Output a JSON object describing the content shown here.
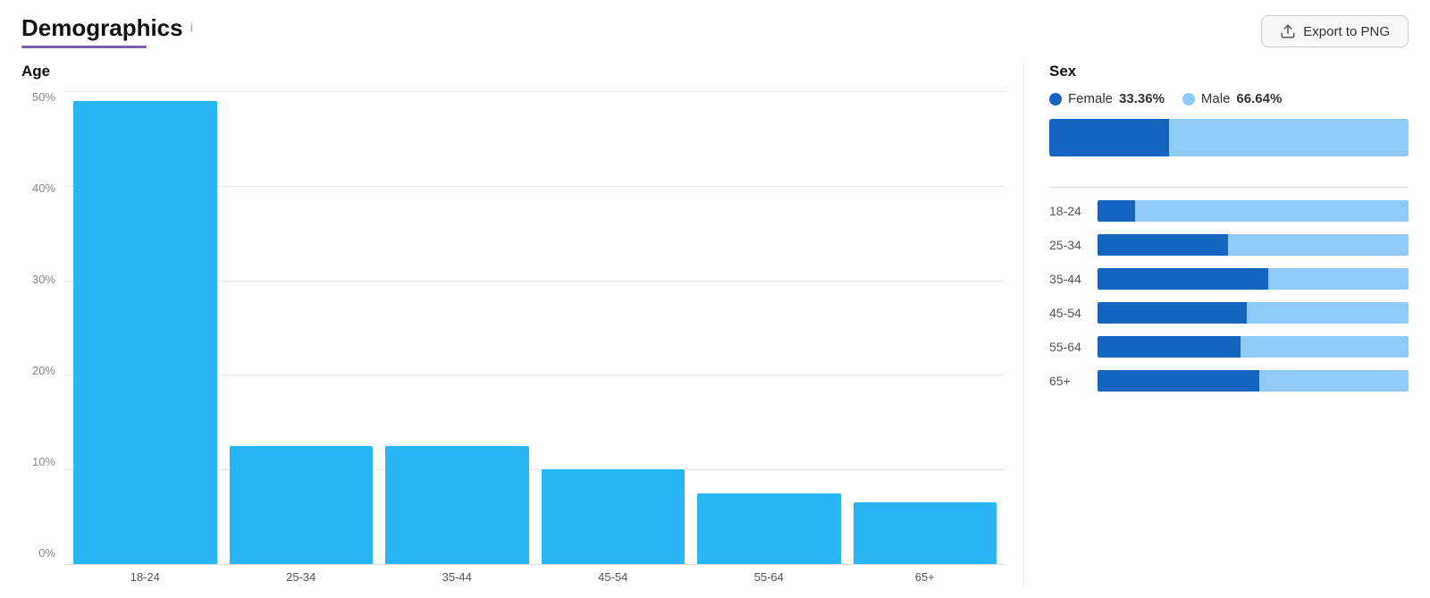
{
  "header": {
    "title": "Demographics",
    "info_icon": "i",
    "export_button_label": "Export to PNG"
  },
  "age_chart": {
    "section_label": "Age",
    "y_axis_labels": [
      "50%",
      "40%",
      "30%",
      "20%",
      "10%",
      "0%"
    ],
    "bars": [
      {
        "label": "18-24",
        "value": 49,
        "max": 50
      },
      {
        "label": "25-34",
        "value": 12.5,
        "max": 50
      },
      {
        "label": "35-44",
        "value": 12.5,
        "max": 50
      },
      {
        "label": "45-54",
        "value": 10,
        "max": 50
      },
      {
        "label": "55-64",
        "value": 7.5,
        "max": 50
      },
      {
        "label": "65+",
        "value": 6.5,
        "max": 50
      }
    ]
  },
  "sex_chart": {
    "section_label": "Sex",
    "female_label": "Female",
    "female_pct": "33.36%",
    "male_label": "Male",
    "male_pct": "66.64%",
    "female_ratio": 33.36,
    "male_ratio": 66.64,
    "female_color": "#1565c0",
    "male_color": "#90caf9",
    "age_rows": [
      {
        "label": "18-24",
        "female": 12,
        "male": 88
      },
      {
        "label": "25-34",
        "female": 42,
        "male": 58
      },
      {
        "label": "35-44",
        "female": 55,
        "male": 45
      },
      {
        "label": "45-54",
        "female": 48,
        "male": 52
      },
      {
        "label": "55-64",
        "female": 46,
        "male": 54
      },
      {
        "label": "65+",
        "female": 52,
        "male": 48
      }
    ]
  }
}
